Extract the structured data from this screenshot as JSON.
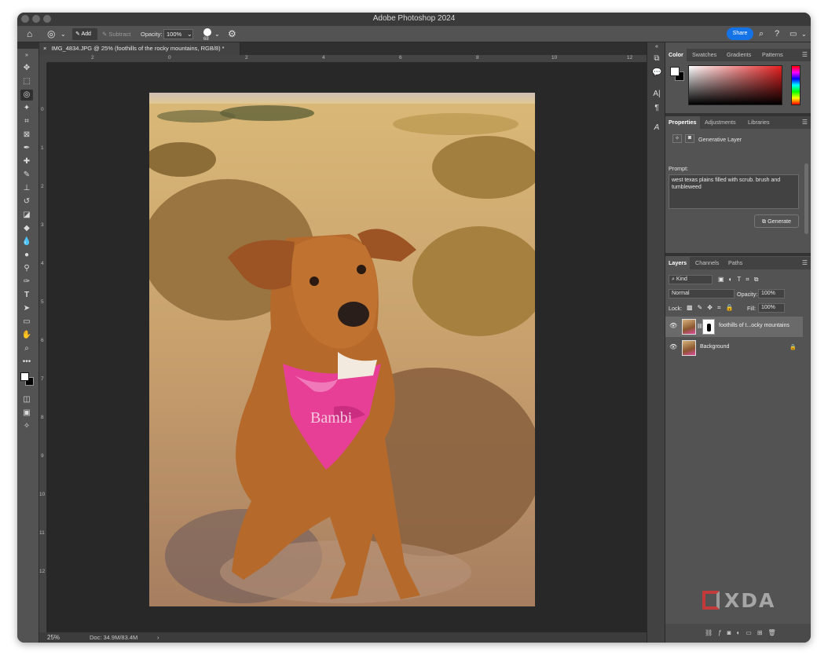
{
  "window": {
    "title": "Adobe Photoshop 2024"
  },
  "options_bar": {
    "mode_add": "Add",
    "mode_subtract": "Subtract",
    "opacity_label": "Opacity:",
    "opacity_value": "100%",
    "brush_size": "68",
    "share_label": "Share"
  },
  "document": {
    "tab_title": "IMG_4834.JPG @ 25% (foothills of the rocky mountains, RGB/8) *",
    "close_glyph": "×",
    "zoom": "25%",
    "doc_info": "Doc: 34.9M/83.4M",
    "h_ruler": [
      "2",
      "0",
      "2",
      "4",
      "6",
      "8",
      "10",
      "12"
    ],
    "v_ruler": [
      "0",
      "1",
      "2",
      "3",
      "4",
      "5",
      "6",
      "7",
      "8",
      "9",
      "10",
      "11",
      "12"
    ]
  },
  "color_panel": {
    "tabs": [
      "Color",
      "Swatches",
      "Gradients",
      "Patterns"
    ],
    "foreground": "#ffffff",
    "background": "#000000"
  },
  "properties_panel": {
    "tabs": [
      "Properties",
      "Adjustments",
      "Libraries"
    ],
    "layer_type": "Generative Layer",
    "prompt_label": "Prompt:",
    "prompt_text": "west texas plains filled with scrub. brush and tumbleweed",
    "generate_label": "Generate"
  },
  "layers_panel": {
    "tabs": [
      "Layers",
      "Channels",
      "Paths"
    ],
    "filter_kind": "Kind",
    "blend_mode": "Normal",
    "opacity_label": "Opacity:",
    "opacity_value": "100%",
    "lock_label": "Lock:",
    "fill_label": "Fill:",
    "fill_value": "100%",
    "layers": [
      {
        "name": "foothills of t...ocky mountains"
      },
      {
        "name": "Background"
      }
    ]
  },
  "watermark": {
    "text": "XDA"
  },
  "photo": {
    "bandana_text": "Bambi"
  }
}
